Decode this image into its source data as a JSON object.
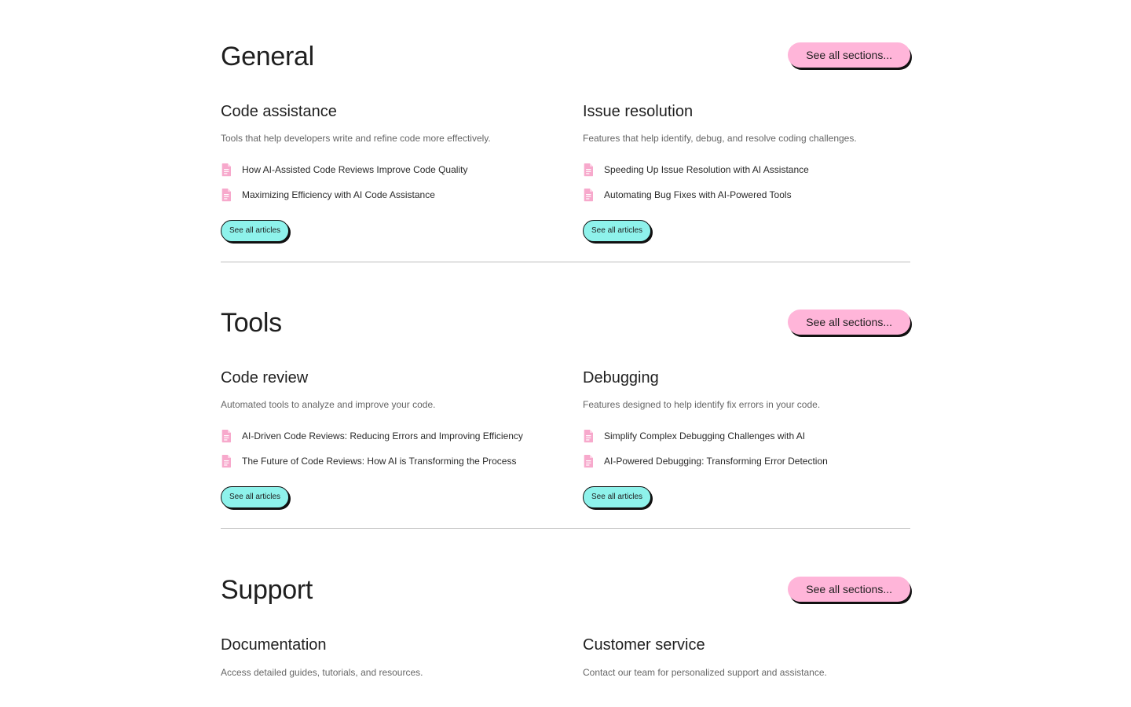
{
  "sections": [
    {
      "title": "General",
      "button_label": "See all sections...",
      "categories": [
        {
          "title": "Code assistance",
          "description": "Tools that help developers write and refine code more effectively.",
          "articles": [
            "How AI-Assisted Code Reviews Improve Code Quality",
            "Maximizing Efficiency with AI Code Assistance"
          ],
          "button_label": "See all articles"
        },
        {
          "title": "Issue resolution",
          "description": "Features that help identify, debug, and resolve coding challenges.",
          "articles": [
            "Speeding Up Issue Resolution with AI Assistance",
            "Automating Bug Fixes with AI-Powered Tools"
          ],
          "button_label": "See all articles"
        }
      ]
    },
    {
      "title": "Tools",
      "button_label": "See all sections...",
      "categories": [
        {
          "title": "Code review",
          "description": "Automated tools to analyze and improve your code.",
          "articles": [
            "AI-Driven Code Reviews: Reducing Errors and Improving Efficiency",
            "The Future of Code Reviews: How AI is Transforming the Process"
          ],
          "button_label": "See all articles"
        },
        {
          "title": "Debugging",
          "description": "Features designed to help identify fix errors in your code.",
          "articles": [
            "Simplify Complex Debugging Challenges with AI",
            "AI-Powered Debugging: Transforming Error Detection"
          ],
          "button_label": "See all articles"
        }
      ]
    },
    {
      "title": "Support",
      "button_label": "See all sections...",
      "categories": [
        {
          "title": "Documentation",
          "description": "Access detailed guides, tutorials, and resources."
        },
        {
          "title": "Customer service",
          "description": "Contact our team for personalized support and assistance."
        }
      ]
    }
  ],
  "icons": {
    "article": "document-icon"
  },
  "colors": {
    "section_button_bg": "#ffb5d9",
    "article_button_bg": "#8ef2eb",
    "doc_icon": "#f7a9cc",
    "divider": "#bdbdbd"
  }
}
